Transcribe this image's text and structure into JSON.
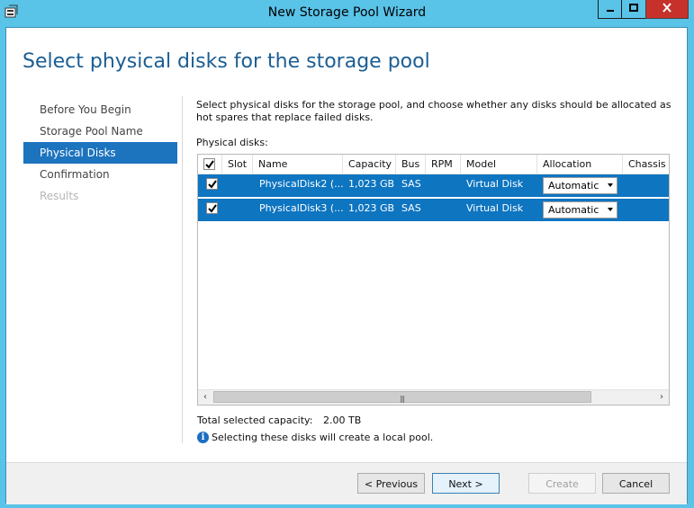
{
  "window": {
    "title": "New Storage Pool Wizard"
  },
  "page": {
    "title": "Select physical disks for the storage pool"
  },
  "nav": {
    "items": [
      {
        "label": "Before You Begin",
        "state": "normal"
      },
      {
        "label": "Storage Pool Name",
        "state": "normal"
      },
      {
        "label": "Physical Disks",
        "state": "active"
      },
      {
        "label": "Confirmation",
        "state": "normal"
      },
      {
        "label": "Results",
        "state": "disabled"
      }
    ]
  },
  "content": {
    "description": "Select physical disks for the storage pool, and choose whether any disks should be allocated as hot spares that replace failed disks.",
    "disks_label": "Physical disks:"
  },
  "table": {
    "columns": [
      "Slot",
      "Name",
      "Capacity",
      "Bus",
      "RPM",
      "Model",
      "Allocation",
      "Chassis"
    ],
    "rows": [
      {
        "slot": "",
        "name": "PhysicalDisk2 (...",
        "capacity": "1,023 GB",
        "bus": "SAS",
        "rpm": "",
        "model": "Virtual Disk",
        "allocation": "Automatic",
        "chassis": ""
      },
      {
        "slot": "",
        "name": "PhysicalDisk3 (...",
        "capacity": "1,023 GB",
        "bus": "SAS",
        "rpm": "",
        "model": "Virtual Disk",
        "allocation": "Automatic",
        "chassis": ""
      }
    ]
  },
  "summary": {
    "total_label": "Total selected capacity:",
    "total_value": "2.00 TB",
    "info_text": "Selecting these disks will create a local pool."
  },
  "buttons": {
    "previous": "< Previous",
    "next": "Next >",
    "create": "Create",
    "cancel": "Cancel"
  },
  "colors": {
    "window_frame": "#5ac3e8",
    "title_accent": "#1b5e93",
    "selection": "#0e75c1",
    "close_button": "#c7312b"
  }
}
